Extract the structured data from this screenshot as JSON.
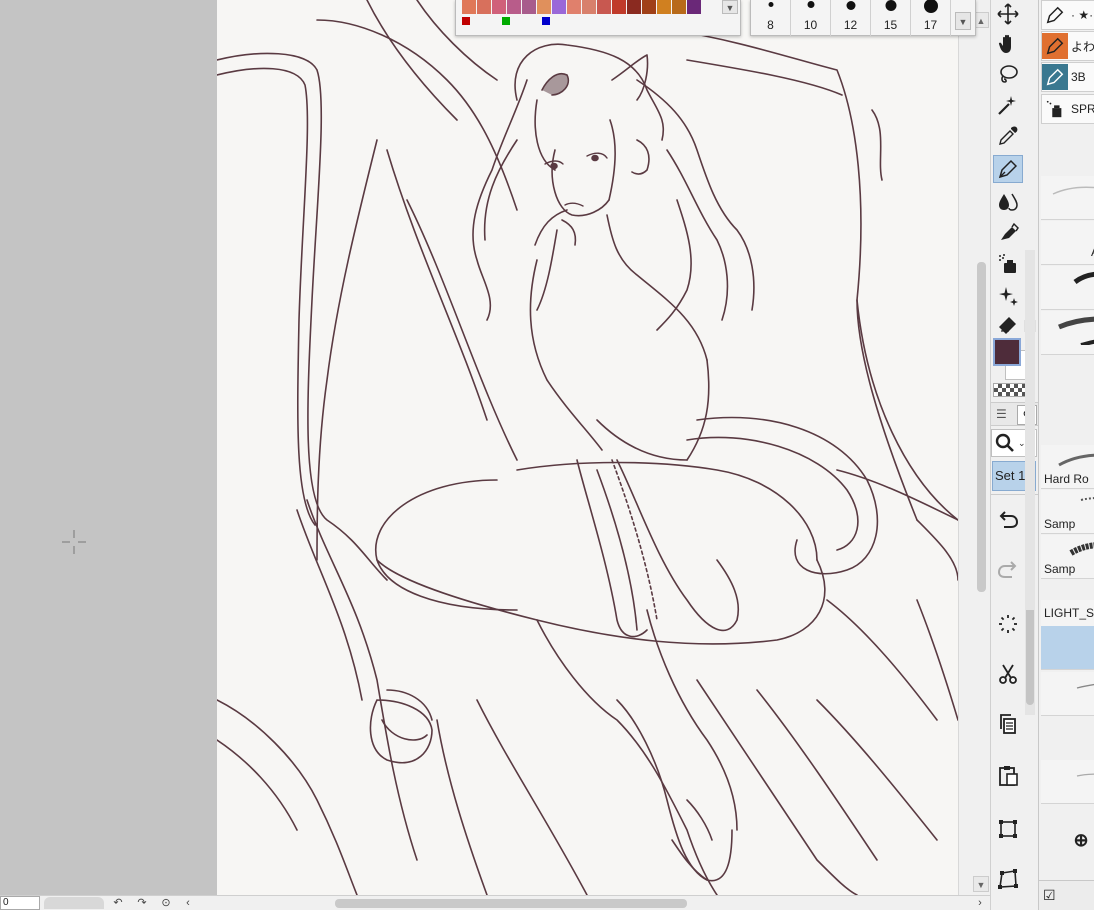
{
  "color_palette": {
    "swatches": [
      "#e07858",
      "#d8705c",
      "#d0607a",
      "#b85c8a",
      "#a85c8c",
      "#e0905c",
      "#9a68d8",
      "#e0806c",
      "#d8806c",
      "#c85850",
      "#c03a2a",
      "#8a2a20",
      "#a04018",
      "#d08020",
      "#b86a1a",
      "#6a2878"
    ],
    "rgb_dots": [
      "#c00000",
      "#00aa00",
      "#0000cc"
    ]
  },
  "brush_sizes": [
    {
      "label": "8"
    },
    {
      "label": "10"
    },
    {
      "label": "12"
    },
    {
      "label": "15"
    },
    {
      "label": "17"
    }
  ],
  "bottom_bar": {
    "zoom": "0"
  },
  "subtools": [
    {
      "name": "· ★·"
    },
    {
      "name": "よわ"
    },
    {
      "name": "3B"
    },
    {
      "name": "SPR"
    }
  ],
  "brush_list": [
    {
      "name": ""
    },
    {
      "name": "A"
    },
    {
      "name": ""
    },
    {
      "name": ""
    },
    {
      "name": "Hard Ro"
    },
    {
      "name": "Samp"
    },
    {
      "name": "Samp"
    },
    {
      "name": "LIGHT_S"
    },
    {
      "name": ""
    },
    {
      "name": ""
    }
  ],
  "tool_panel": {
    "set_label": "Set 1"
  },
  "colors": {
    "main_color": "#4e2c3a",
    "sub_color": "#ffffff",
    "selection_accent": "#b8d2ea"
  }
}
